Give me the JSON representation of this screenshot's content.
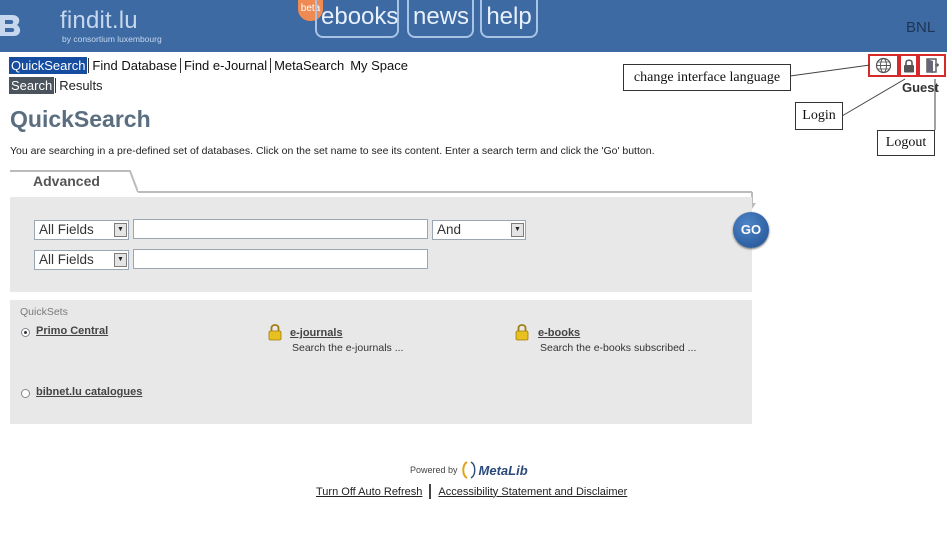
{
  "header": {
    "brand": "findit.lu",
    "brand_sub": "by consortium luxembourg",
    "beta_badge": "beta",
    "tabs": [
      {
        "label": "ebooks"
      },
      {
        "label": "news"
      },
      {
        "label": "help"
      }
    ],
    "institution": "BNL"
  },
  "nav": {
    "items": [
      {
        "label": "QuickSearch",
        "active": true
      },
      {
        "label": "Find Database"
      },
      {
        "label": "Find e-Journal"
      },
      {
        "label": "MetaSearch"
      },
      {
        "label": "My Space"
      }
    ],
    "subitems": [
      {
        "label": "Search",
        "active": true
      },
      {
        "label": "Results"
      }
    ]
  },
  "toolbar": {
    "icons": [
      "globe-icon",
      "lock-icon",
      "logout-door-icon"
    ],
    "user": "Guest"
  },
  "callouts": {
    "language": "change interface language",
    "login": "Login",
    "logout": "Logout"
  },
  "page": {
    "title": "QuickSearch",
    "intro": "You are searching in a pre-defined set of databases. Click on the set name to see its content. Enter a search term and click the 'Go' button."
  },
  "search": {
    "tab_label": "Advanced",
    "rows": [
      {
        "field": "All Fields",
        "value": "",
        "operator": "And"
      },
      {
        "field": "All Fields",
        "value": ""
      }
    ],
    "go_label": "GO"
  },
  "quicksets": {
    "heading": "QuickSets",
    "items": [
      {
        "label": "Primo Central",
        "selected": true
      },
      {
        "label": "e-journals",
        "description": "Search the e-journals ...",
        "locked": true
      },
      {
        "label": "e-books",
        "description": "Search the e-books subscribed ...",
        "locked": true
      },
      {
        "label": "bibnet.lu catalogues",
        "selected": false
      }
    ]
  },
  "footer": {
    "powered_by": "Powered by",
    "product": "MetaLib",
    "links": [
      {
        "label": "Turn Off Auto Refresh"
      },
      {
        "label": "Accessibility Statement and Disclaimer"
      }
    ]
  },
  "colors": {
    "header_bg": "#3d6aa2",
    "nav_active": "#174da0",
    "panel_bg": "#e8e8e8",
    "callout_border": "#d62a2a"
  }
}
